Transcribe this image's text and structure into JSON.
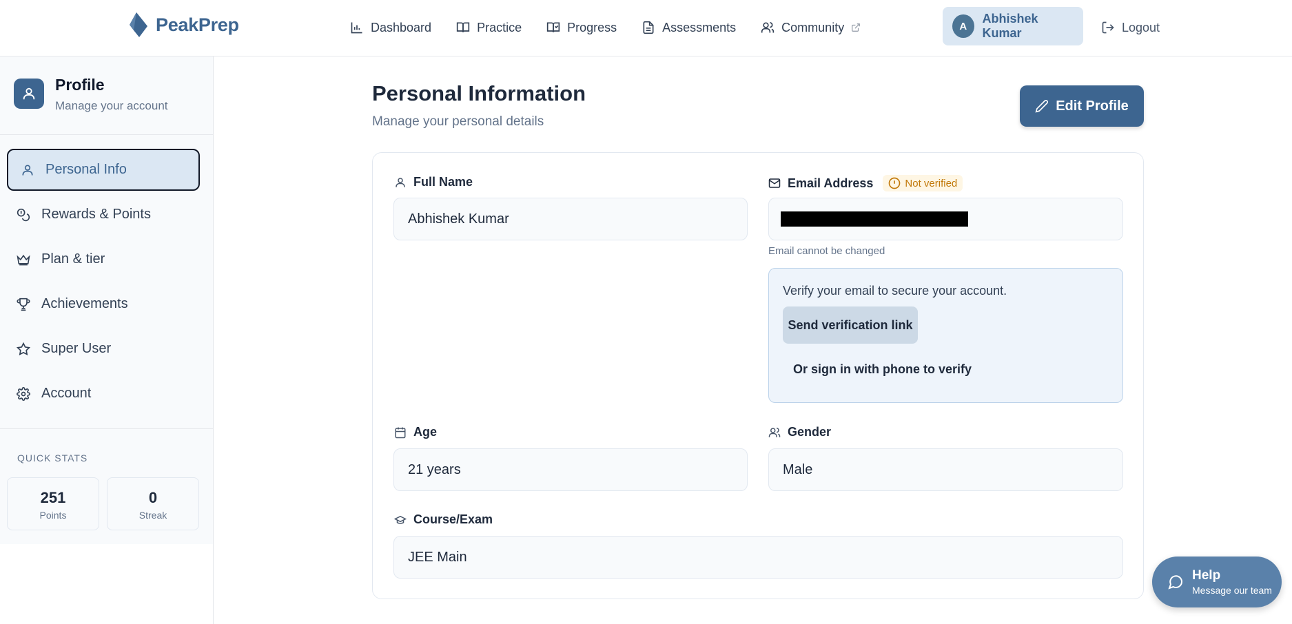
{
  "brand": {
    "name": "PeakPrep"
  },
  "nav": {
    "items": [
      {
        "label": "Dashboard",
        "icon": "bar-chart-icon"
      },
      {
        "label": "Practice",
        "icon": "book-open-icon"
      },
      {
        "label": "Progress",
        "icon": "book-check-icon"
      },
      {
        "label": "Assessments",
        "icon": "file-text-icon"
      },
      {
        "label": "Community",
        "icon": "users-icon"
      }
    ],
    "user": {
      "initial": "A",
      "name": "Abhishek Kumar"
    },
    "logout_label": "Logout"
  },
  "sidebar": {
    "title": "Profile",
    "subtitle": "Manage your account",
    "items": [
      {
        "label": "Personal Info",
        "icon": "user-icon",
        "active": true
      },
      {
        "label": "Rewards & Points",
        "icon": "coins-icon"
      },
      {
        "label": "Plan & tier",
        "icon": "crown-icon"
      },
      {
        "label": "Achievements",
        "icon": "trophy-icon"
      },
      {
        "label": "Super User",
        "icon": "star-icon"
      },
      {
        "label": "Account",
        "icon": "gear-icon"
      }
    ],
    "quick_stats": {
      "label": "QUICK STATS",
      "points": {
        "value": "251",
        "label": "Points"
      },
      "streak": {
        "value": "0",
        "label": "Streak"
      }
    }
  },
  "main": {
    "title": "Personal Information",
    "subtitle": "Manage your personal details",
    "edit_label": "Edit Profile",
    "full_name": {
      "label": "Full Name",
      "value": "Abhishek Kumar"
    },
    "email": {
      "label": "Email Address",
      "badge": "Not verified",
      "hint": "Email cannot be changed",
      "verify_text": "Verify your email to secure your account.",
      "send_label": "Send verification link",
      "phone_label": "Or sign in with phone to verify"
    },
    "age": {
      "label": "Age",
      "value": "21 years"
    },
    "gender": {
      "label": "Gender",
      "value": "Male"
    },
    "course": {
      "label": "Course/Exam",
      "value": "JEE Main"
    }
  },
  "help": {
    "title": "Help",
    "subtitle": "Message our team"
  },
  "colors": {
    "primary": "#3d6590",
    "accent_light": "#dbe7f3",
    "warning": "#c2790a"
  }
}
